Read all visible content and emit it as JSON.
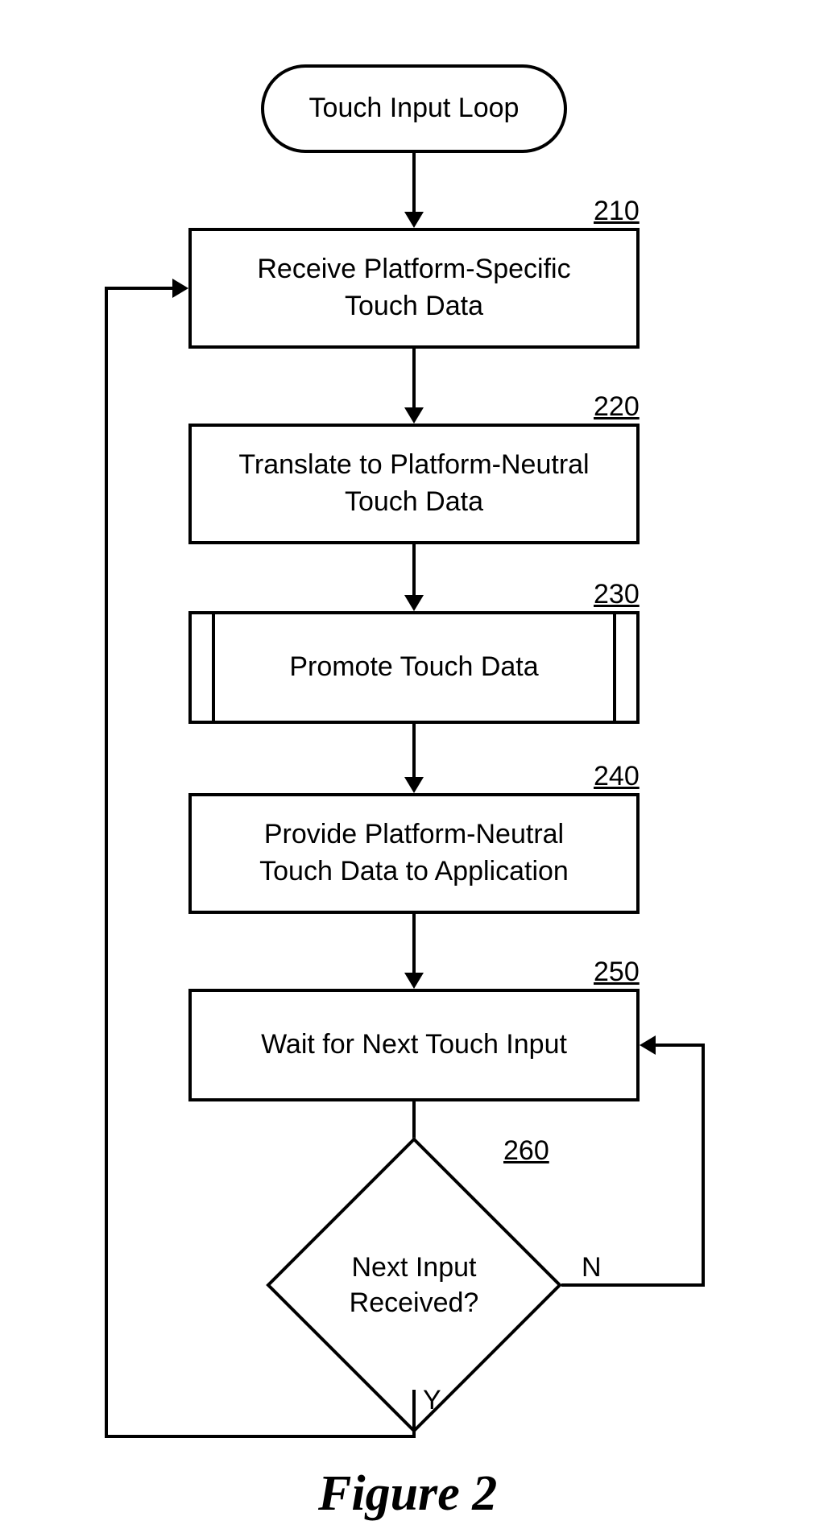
{
  "title": "Touch Input Loop",
  "steps": {
    "s210": {
      "ref": "210",
      "text": "Receive Platform-Specific\nTouch Data"
    },
    "s220": {
      "ref": "220",
      "text": "Translate to Platform-Neutral\nTouch Data"
    },
    "s230": {
      "ref": "230",
      "text": "Promote Touch Data"
    },
    "s240": {
      "ref": "240",
      "text": "Provide Platform-Neutral\nTouch Data to Application"
    },
    "s250": {
      "ref": "250",
      "text": "Wait for Next Touch Input"
    },
    "s260": {
      "ref": "260",
      "text": "Next Input\nReceived?"
    }
  },
  "edges": {
    "yes": "Y",
    "no": "N"
  },
  "figure": "Figure 2"
}
